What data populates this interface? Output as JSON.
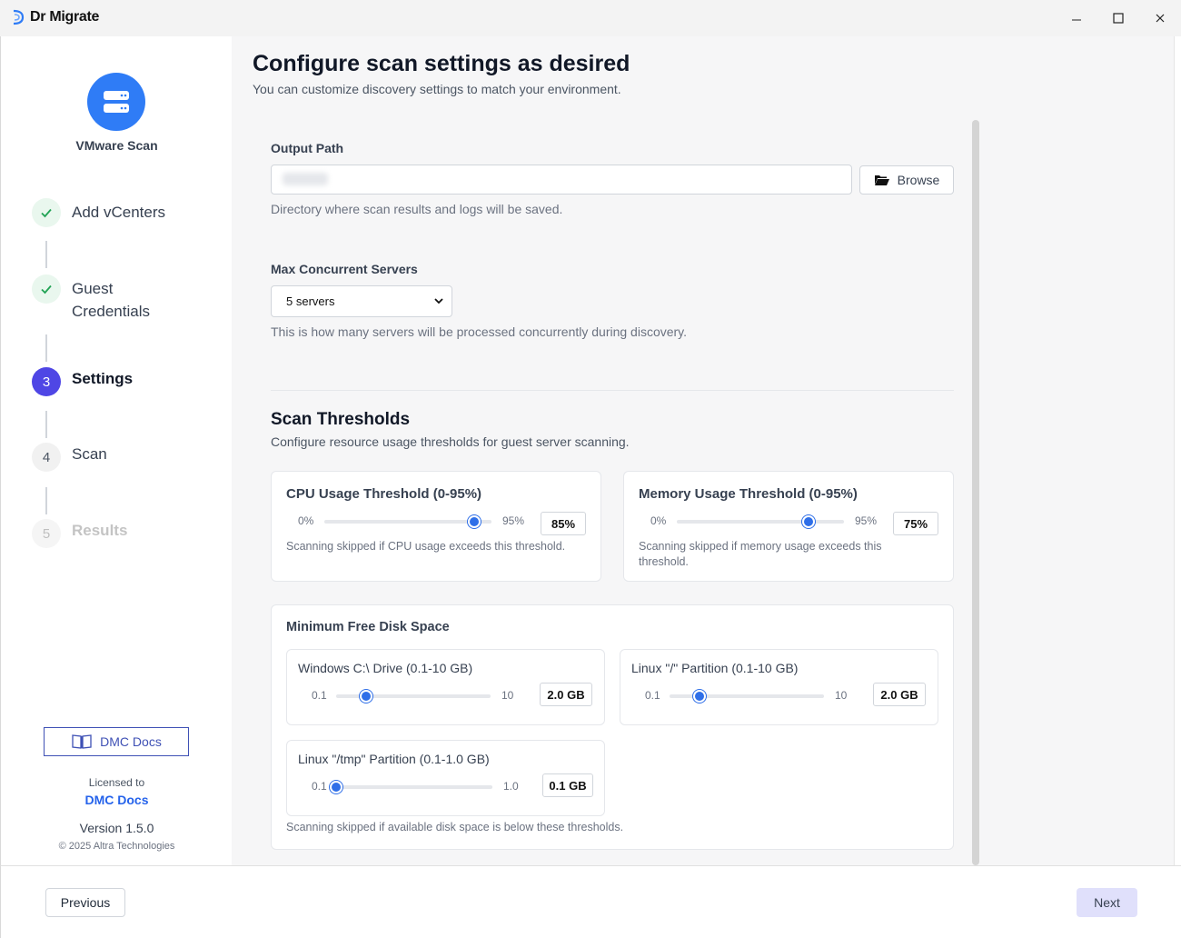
{
  "window": {
    "title": "Dr Migrate",
    "minimize_glyph": "—",
    "maximize_glyph": "☐",
    "close_glyph": "✕"
  },
  "sidebar": {
    "scan_title": "VMware Scan",
    "steps": [
      {
        "number": "1",
        "label": "Add vCenters",
        "state": "done"
      },
      {
        "number": "2",
        "label": "Guest Credentials",
        "state": "done"
      },
      {
        "number": "3",
        "label": "Settings",
        "state": "active"
      },
      {
        "number": "4",
        "label": "Scan",
        "state": "todo"
      },
      {
        "number": "5",
        "label": "Results",
        "state": "disabled"
      }
    ],
    "docs_button": "DMC Docs",
    "licensed_to_label": "Licensed to",
    "licensee": "DMC Docs",
    "version": "Version 1.5.0",
    "copyright": "© 2025 Altra Technologies"
  },
  "main": {
    "title": "Configure scan settings as desired",
    "subtitle": "You can customize discovery settings to match your environment.",
    "output_path": {
      "label": "Output Path",
      "value": "",
      "browse_label": "Browse",
      "help": "Directory where scan results and logs will be saved."
    },
    "max_concurrent": {
      "label": "Max Concurrent Servers",
      "selected": "5 servers",
      "help": "This is how many servers will be processed concurrently during discovery."
    },
    "thresholds": {
      "title": "Scan Thresholds",
      "subtitle": "Configure resource usage thresholds for guest server scanning.",
      "cpu": {
        "title": "CPU Usage Threshold (0-95%)",
        "min": "0%",
        "max": "95%",
        "value": "85%",
        "fraction": 0.895,
        "help": "Scanning skipped if CPU usage exceeds this threshold."
      },
      "memory": {
        "title": "Memory Usage Threshold (0-95%)",
        "min": "0%",
        "max": "95%",
        "value": "75%",
        "fraction": 0.789,
        "help": "Scanning skipped if memory usage exceeds this threshold."
      }
    },
    "disk": {
      "title": "Minimum Free Disk Space",
      "windows": {
        "title": "Windows C:\\ Drive (0.1-10 GB)",
        "min": "0.1",
        "max": "10",
        "value": "2.0 GB",
        "fraction": 0.192
      },
      "linux_root": {
        "title": "Linux \"/\" Partition (0.1-10 GB)",
        "min": "0.1",
        "max": "10",
        "value": "2.0 GB",
        "fraction": 0.192
      },
      "linux_tmp": {
        "title": "Linux \"/tmp\" Partition (0.1-1.0 GB)",
        "min": "0.1",
        "max": "1.0",
        "value": "0.1 GB",
        "fraction": 0.0
      },
      "help": "Scanning skipped if available disk space is below these thresholds."
    }
  },
  "footer": {
    "previous": "Previous",
    "next": "Next"
  },
  "colors": {
    "accent": "#2f7cf6",
    "active_step": "#4f46e5",
    "done": "#22a355",
    "slider_thumb": "#2f6fe8",
    "next_button_bg": "#e0e0fb"
  }
}
